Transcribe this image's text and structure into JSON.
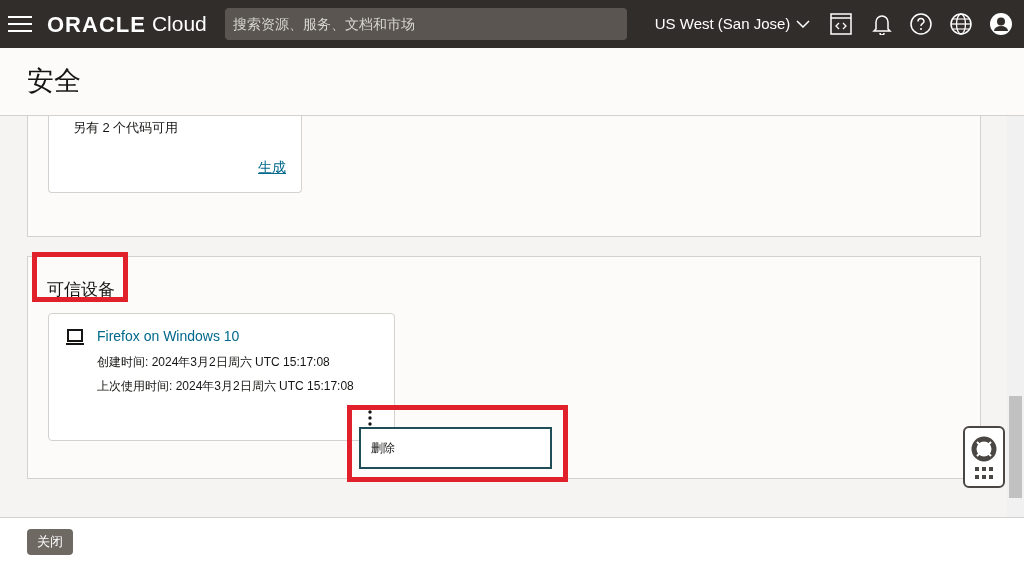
{
  "header": {
    "brand": "ORACLE",
    "brand_suffix": "Cloud",
    "search": {
      "placeholder": "搜索资源、服务、文档和市场"
    },
    "region": "US West (San Jose)"
  },
  "page_title": "安全",
  "code_panel": {
    "note": "另有 2 个代码可用",
    "link": "生成"
  },
  "devices_panel": {
    "title": "可信设备",
    "devices": [
      {
        "name": "Firefox on Windows 10",
        "created": "创建时间: 2024年3月2日周六 UTC 15:17:08",
        "last_used": "上次使用时间: 2024年3月2日周六 UTC 15:17:08",
        "menu_open": true,
        "menu_items": [
          "删除"
        ]
      }
    ]
  },
  "footer": {
    "close_button": "关闭"
  }
}
